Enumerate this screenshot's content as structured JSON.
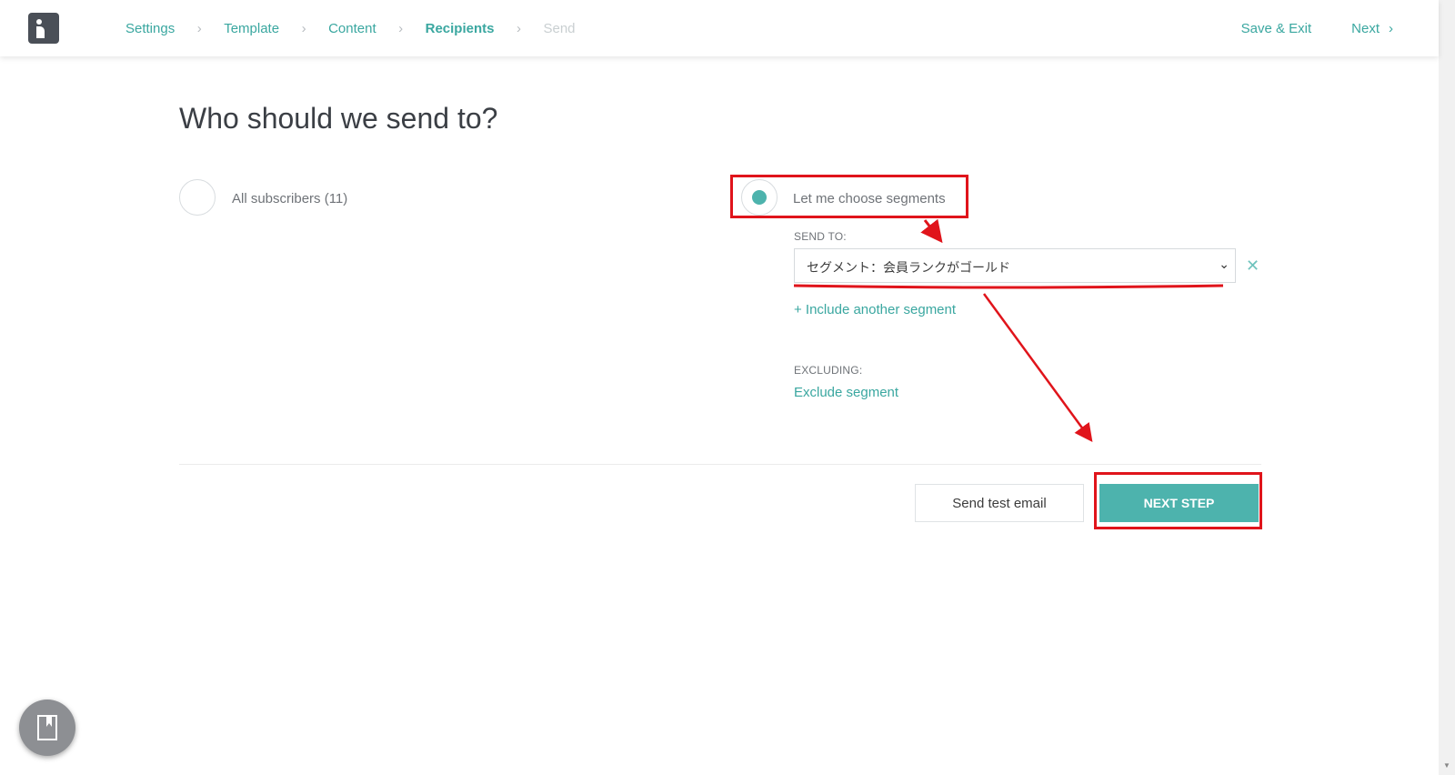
{
  "nav": {
    "breadcrumbs": [
      {
        "label": "Settings"
      },
      {
        "label": "Template"
      },
      {
        "label": "Content"
      },
      {
        "label": "Recipients"
      },
      {
        "label": "Send"
      }
    ],
    "save_exit": "Save & Exit",
    "next": "Next"
  },
  "page": {
    "title": "Who should we send to?"
  },
  "options": {
    "all_subscribers": "All subscribers (11)",
    "choose_segments": "Let me choose segments",
    "selected": "choose_segments"
  },
  "segments": {
    "send_to_label": "SEND TO:",
    "selected_segment": "セグメント：会員ランクがゴールド",
    "include_another": "+ Include another segment",
    "excluding_label": "EXCLUDING:",
    "exclude_link": "Exclude segment"
  },
  "actions": {
    "send_test": "Send test email",
    "next_step": "NEXT STEP"
  },
  "colors": {
    "accent": "#4db3ad",
    "link": "#3aa7a0",
    "annotation": "#e0141b"
  }
}
